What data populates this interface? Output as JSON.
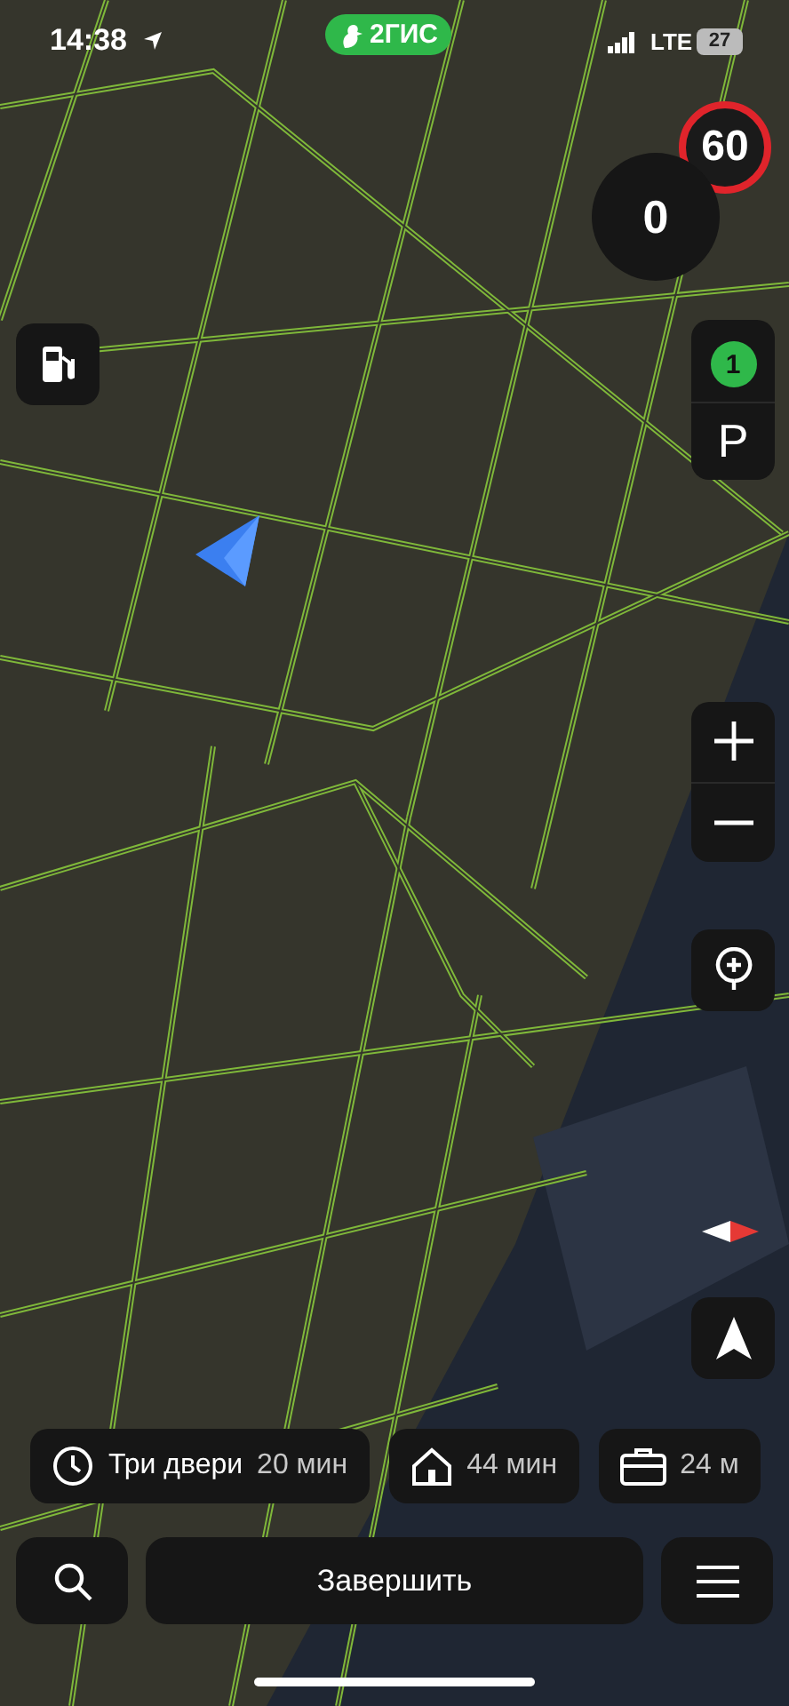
{
  "status_bar": {
    "time": "14:38",
    "network": "LTE",
    "battery": "27"
  },
  "app_badge": {
    "label": "2ГИС"
  },
  "speed_limit": "60",
  "speed": "0",
  "parking": {
    "count": "1",
    "label": "P"
  },
  "route_chips": [
    {
      "kind": "clock",
      "name": "Три двери",
      "time": "20 мин"
    },
    {
      "kind": "home",
      "time": "44 мин"
    },
    {
      "kind": "work",
      "time": "24 м"
    }
  ],
  "finish_button": "Завершить"
}
